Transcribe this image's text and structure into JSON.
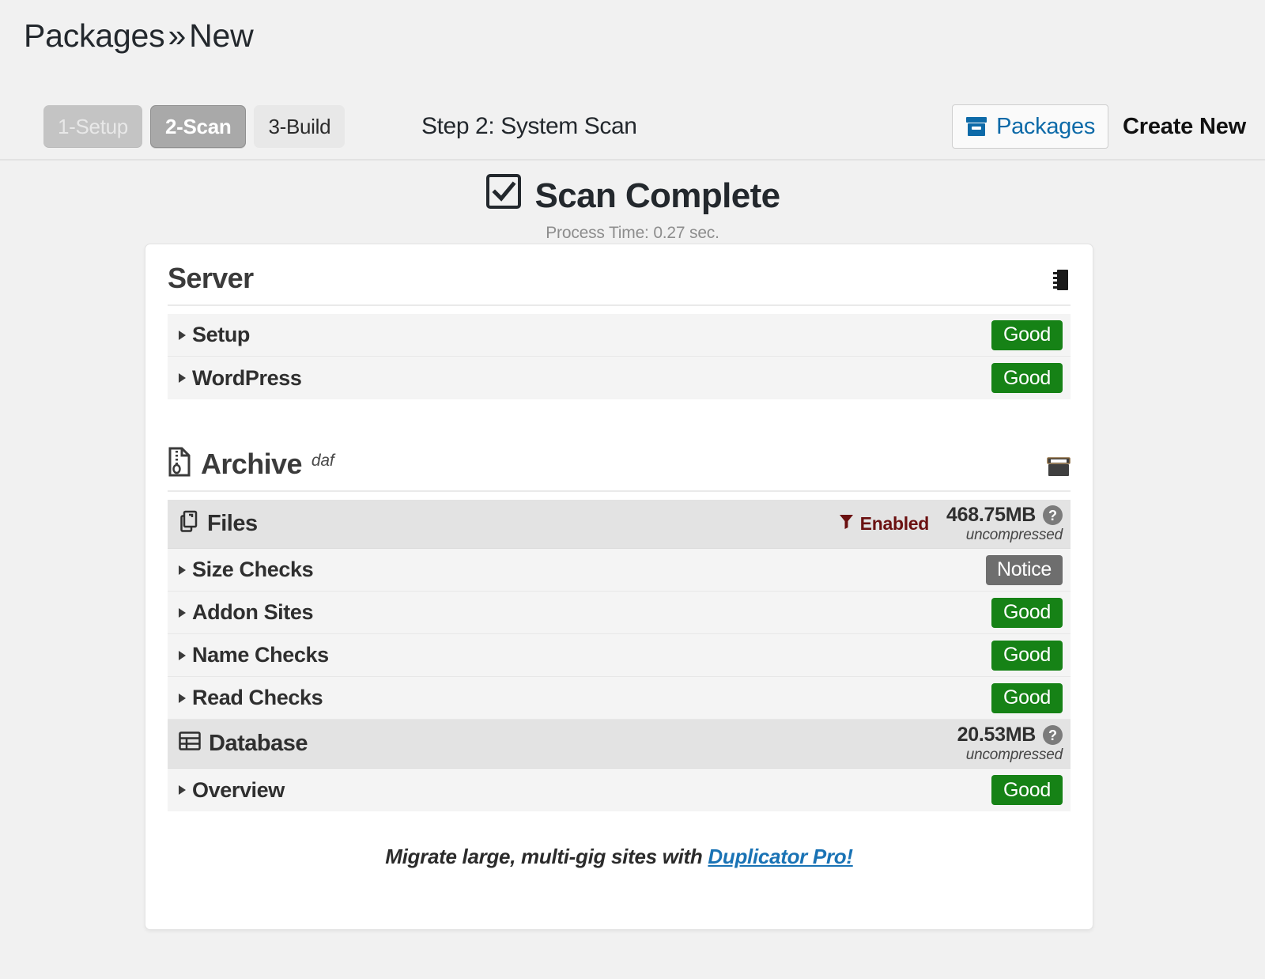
{
  "breadcrumb": {
    "root": "Packages",
    "separator": "»",
    "current": "New"
  },
  "steps": [
    {
      "label": "1-Setup",
      "state": "done"
    },
    {
      "label": "2-Scan",
      "state": "current"
    },
    {
      "label": "3-Build",
      "state": "todo"
    }
  ],
  "step_title": "Step 2: System Scan",
  "header": {
    "packages_button": "Packages",
    "packages_icon": "archive-box-icon",
    "create_new": "Create New"
  },
  "scan": {
    "status_icon": "checkbox-checked-icon",
    "status": "Scan Complete",
    "process_time": "Process Time: 0.27 sec."
  },
  "sections": [
    {
      "title": "Server",
      "superscript": "",
      "left_icon": "",
      "right_icon": "microchip-icon",
      "rows": [
        {
          "label": "Setup",
          "badge": "Good",
          "badge_type": "good"
        },
        {
          "label": "WordPress",
          "badge": "Good",
          "badge_type": "good"
        }
      ]
    },
    {
      "title": "Archive",
      "superscript": "daf",
      "left_icon": "file-archive-icon",
      "right_icon": "archive-box-icon",
      "groups": [
        {
          "label": "Files",
          "icon": "copy-files-icon",
          "filter_icon": "filter-icon",
          "filter_label": "Enabled",
          "size": "468.75MB",
          "size_note": "uncompressed",
          "help_icon": "question-circle-icon",
          "rows": [
            {
              "label": "Size Checks",
              "badge": "Notice",
              "badge_type": "notice"
            },
            {
              "label": "Addon Sites",
              "badge": "Good",
              "badge_type": "good"
            },
            {
              "label": "Name Checks",
              "badge": "Good",
              "badge_type": "good"
            },
            {
              "label": "Read Checks",
              "badge": "Good",
              "badge_type": "good"
            }
          ]
        },
        {
          "label": "Database",
          "icon": "table-grid-icon",
          "filter_icon": "",
          "filter_label": "",
          "size": "20.53MB",
          "size_note": "uncompressed",
          "help_icon": "question-circle-icon",
          "rows": [
            {
              "label": "Overview",
              "badge": "Good",
              "badge_type": "good"
            }
          ]
        }
      ]
    }
  ],
  "promo": {
    "text_before": "Migrate large, multi-gig sites with ",
    "link": "Duplicator Pro!"
  },
  "colors": {
    "good": "#168216",
    "notice": "#6e6e6e",
    "link": "#1a73b5",
    "enabled": "#6b1111",
    "page_bg": "#f1f1f1"
  }
}
